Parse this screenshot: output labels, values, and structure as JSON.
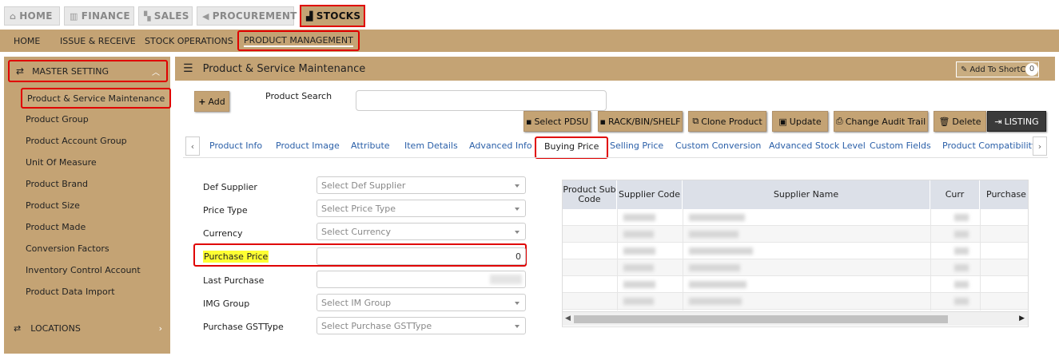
{
  "top_tabs": [
    {
      "label": "HOME",
      "icon": "home-icon",
      "glyph": "⌂"
    },
    {
      "label": "FINANCE",
      "icon": "bank-icon",
      "glyph": "🏛"
    },
    {
      "label": "SALES",
      "icon": "cart-icon",
      "glyph": "🛒"
    },
    {
      "label": "PROCUREMENT",
      "icon": "megaphone-icon",
      "glyph": "📢"
    },
    {
      "label": "STOCKS",
      "icon": "factory-icon",
      "glyph": "🏭"
    }
  ],
  "subnav": [
    "HOME",
    "ISSUE & RECEIVE",
    "STOCK OPERATIONS",
    "PRODUCT MANAGEMENT"
  ],
  "sidebar": {
    "section": "MASTER SETTING",
    "items": [
      "Product & Service Maintenance",
      "Product Group",
      "Product Account Group",
      "Unit Of Measure",
      "Product Brand",
      "Product Size",
      "Product Made",
      "Conversion Factors",
      "Inventory Control Account",
      "Product Data Import"
    ],
    "locations": "LOCATIONS"
  },
  "main": {
    "title": "Product & Service Maintenance",
    "shortcut_label": "Add To ShortCut",
    "shortcut_count": "0",
    "add_label": "Add",
    "search_label": "Product Search",
    "search_value": ""
  },
  "toolbar": [
    "Select PDSU",
    "RACK/BIN/SHELF",
    "Clone Product",
    "Update",
    "Change Audit Trail",
    "Delete",
    "LISTING"
  ],
  "product_tabs": [
    "Product Info",
    "Product Image",
    "Attribute",
    "Item Details",
    "Advanced Info",
    "Buying Price",
    "Selling Price",
    "Custom Conversion",
    "Advanced Stock Level",
    "Custom Fields",
    "Product Compatibility"
  ],
  "form": {
    "def_supplier": {
      "label": "Def Supplier",
      "placeholder": "Select Def Supplier"
    },
    "price_type": {
      "label": "Price Type",
      "placeholder": "Select Price Type"
    },
    "currency": {
      "label": "Currency",
      "placeholder": "Select Currency"
    },
    "purchase_price": {
      "label": "Purchase Price",
      "value": "0"
    },
    "last_purchase": {
      "label": "Last Purchase",
      "value": ""
    },
    "img_group": {
      "label": "IMG Group",
      "placeholder": "Select IM Group"
    },
    "purchase_gst": {
      "label": "Purchase GSTType",
      "placeholder": "Select Purchase GSTType"
    }
  },
  "table": {
    "headers": [
      "Product Sub Code",
      "Supplier Code",
      "Supplier Name",
      "Curr",
      "Purchase P"
    ]
  },
  "colors": {
    "accent": "#c4a374",
    "highlight_border": "#e00000",
    "link": "#2a5fa8",
    "dark_button": "#3a3a3a"
  }
}
